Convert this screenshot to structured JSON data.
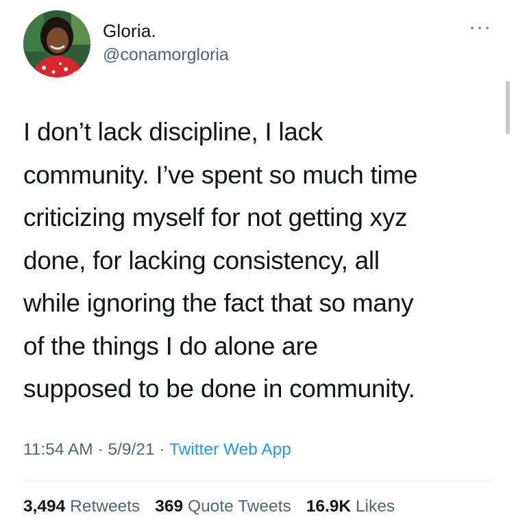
{
  "author": {
    "name": "Gloria.",
    "handle": "@conamorgloria",
    "avatar_icon": "profile-photo"
  },
  "tweet": {
    "text": "I don’t lack discipline, I lack\ncommunity. I’ve spent so much time\ncriticizing myself for not getting xyz\ndone, for lacking consistency, all\nwhile ignoring the fact that so many\nof the things I do alone are\nsupposed to be done in community.",
    "time": "11:54 AM",
    "date": "5/9/21",
    "source": "Twitter Web App",
    "separator": " · "
  },
  "stats": {
    "retweets_count": "3,494",
    "retweets_label": "Retweets",
    "quote_count": "369",
    "quote_label": "Quote Tweets",
    "likes_count": "16.9K",
    "likes_label": "Likes"
  },
  "icons": {
    "more": "more-icon"
  },
  "colors": {
    "text": "#0f1419",
    "secondary": "#536471",
    "link": "#1d9bf0",
    "divider": "#e6ecf0"
  }
}
